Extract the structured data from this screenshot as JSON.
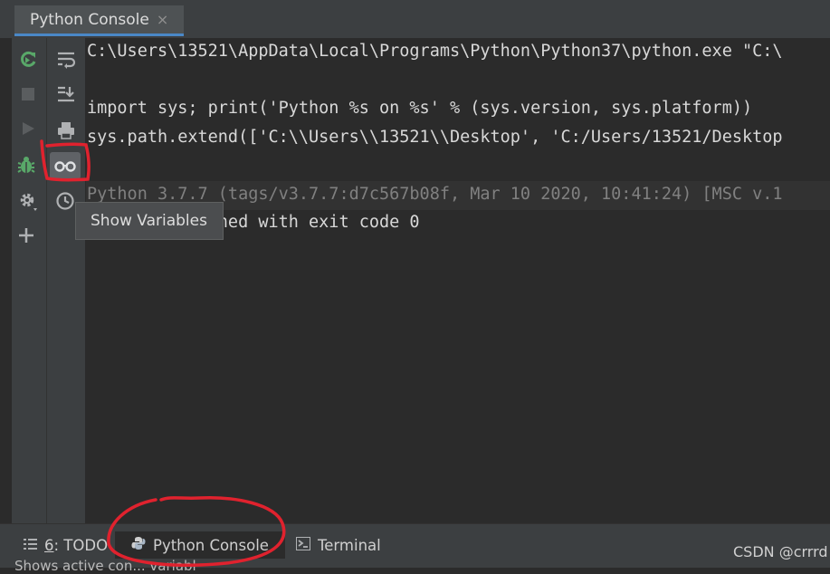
{
  "tab": {
    "title": "Python Console",
    "close": "×"
  },
  "console": {
    "lines": [
      "C:\\Users\\13521\\AppData\\Local\\Programs\\Python\\Python37\\python.exe \"C:\\",
      "",
      "import sys; print('Python %s on %s' % (sys.version, sys.platform))",
      "sys.path.extend(['C:\\\\Users\\\\13521\\\\Desktop', 'C:/Users/13521/Desktop",
      "",
      "Python 3.7.7 (tags/v3.7.7:d7c567b08f, Mar 10 2020, 10:41:24) [MSC v.1",
      "Process finished with exit code 0"
    ]
  },
  "tooltip": {
    "text": "Show Variables"
  },
  "bottom": {
    "todo_num": "6",
    "todo_label": ": TODO",
    "console_label": "Python Console",
    "terminal_label": "Terminal"
  },
  "watermark": "CSDN @crrrd",
  "status_text": "Shows active con... variabl",
  "colors": {
    "accent": "#4a88c7",
    "rerun": "#59a869",
    "annotation": "#e0222e"
  }
}
